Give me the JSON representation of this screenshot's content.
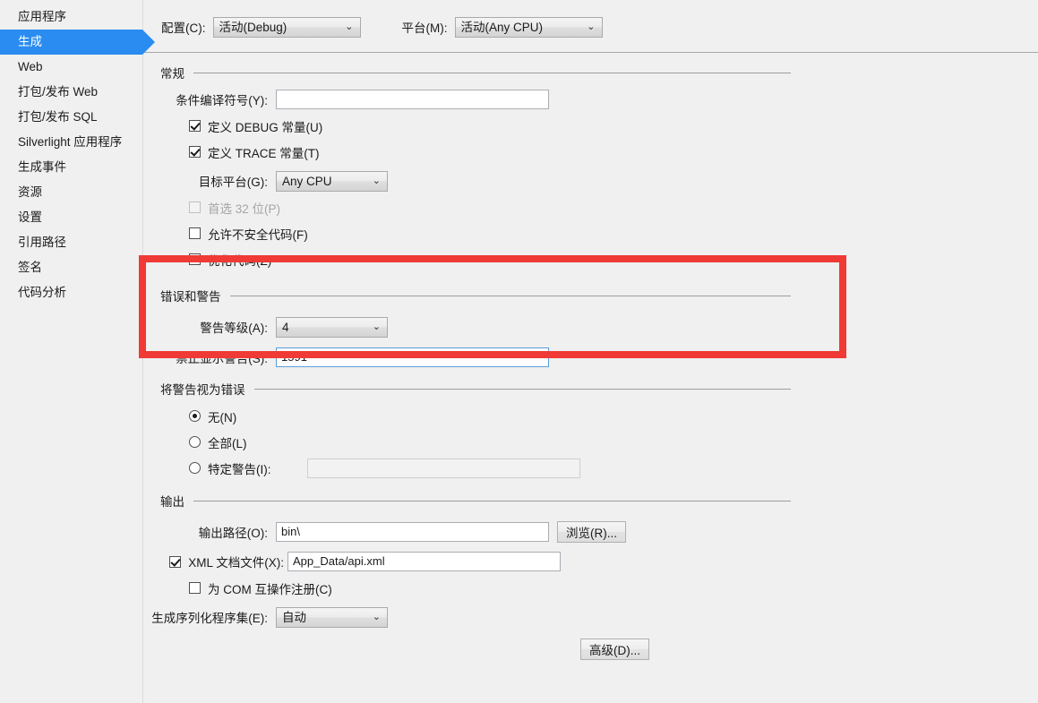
{
  "sidebar": {
    "items": [
      {
        "label": "应用程序",
        "selected": false
      },
      {
        "label": "生成",
        "selected": true
      },
      {
        "label": "Web",
        "selected": false
      },
      {
        "label": "打包/发布 Web",
        "selected": false
      },
      {
        "label": "打包/发布 SQL",
        "selected": false
      },
      {
        "label": "Silverlight 应用程序",
        "selected": false
      },
      {
        "label": "生成事件",
        "selected": false
      },
      {
        "label": "资源",
        "selected": false
      },
      {
        "label": "设置",
        "selected": false
      },
      {
        "label": "引用路径",
        "selected": false
      },
      {
        "label": "签名",
        "selected": false
      },
      {
        "label": "代码分析",
        "selected": false
      }
    ]
  },
  "config_bar": {
    "configuration_label": "配置(C):",
    "configuration_value": "活动(Debug)",
    "platform_label": "平台(M):",
    "platform_value": "活动(Any CPU)",
    "chevron": "⌄"
  },
  "general": {
    "title": "常规",
    "conditional_symbols_label": "条件编译符号(Y):",
    "conditional_symbols_value": "",
    "define_debug_label": "定义 DEBUG 常量(U)",
    "define_debug_checked": true,
    "define_trace_label": "定义 TRACE 常量(T)",
    "define_trace_checked": true,
    "target_platform_label": "目标平台(G):",
    "target_platform_value": "Any CPU",
    "prefer32_label": "首选 32 位(P)",
    "prefer32_checked": false,
    "prefer32_disabled": true,
    "unsafe_label": "允许不安全代码(F)",
    "unsafe_checked": false,
    "optimize_label": "优化代码(Z)",
    "optimize_checked": false
  },
  "errors_warnings": {
    "title": "错误和警告",
    "warning_level_label": "警告等级(A):",
    "warning_level_value": "4",
    "suppress_warnings_label": "禁止显示警告(S):",
    "suppress_warnings_value": "1591",
    "highlight_color": "#ef3a36"
  },
  "treat_warnings": {
    "title": "将警告视为错误",
    "none_label": "无(N)",
    "none_selected": true,
    "all_label": "全部(L)",
    "all_selected": false,
    "specific_label": "特定警告(I):",
    "specific_selected": false,
    "specific_value": ""
  },
  "output": {
    "title": "输出",
    "output_path_label": "输出路径(O):",
    "output_path_value": "bin\\",
    "browse_button": "浏览(R)...",
    "xml_doc_label": "XML 文档文件(X):",
    "xml_doc_checked": true,
    "xml_doc_value": "App_Data/api.xml",
    "com_interop_label": "为 COM 互操作注册(C)",
    "com_interop_checked": false,
    "serialization_label": "生成序列化程序集(E):",
    "serialization_value": "自动",
    "advanced_button": "高级(D)..."
  }
}
